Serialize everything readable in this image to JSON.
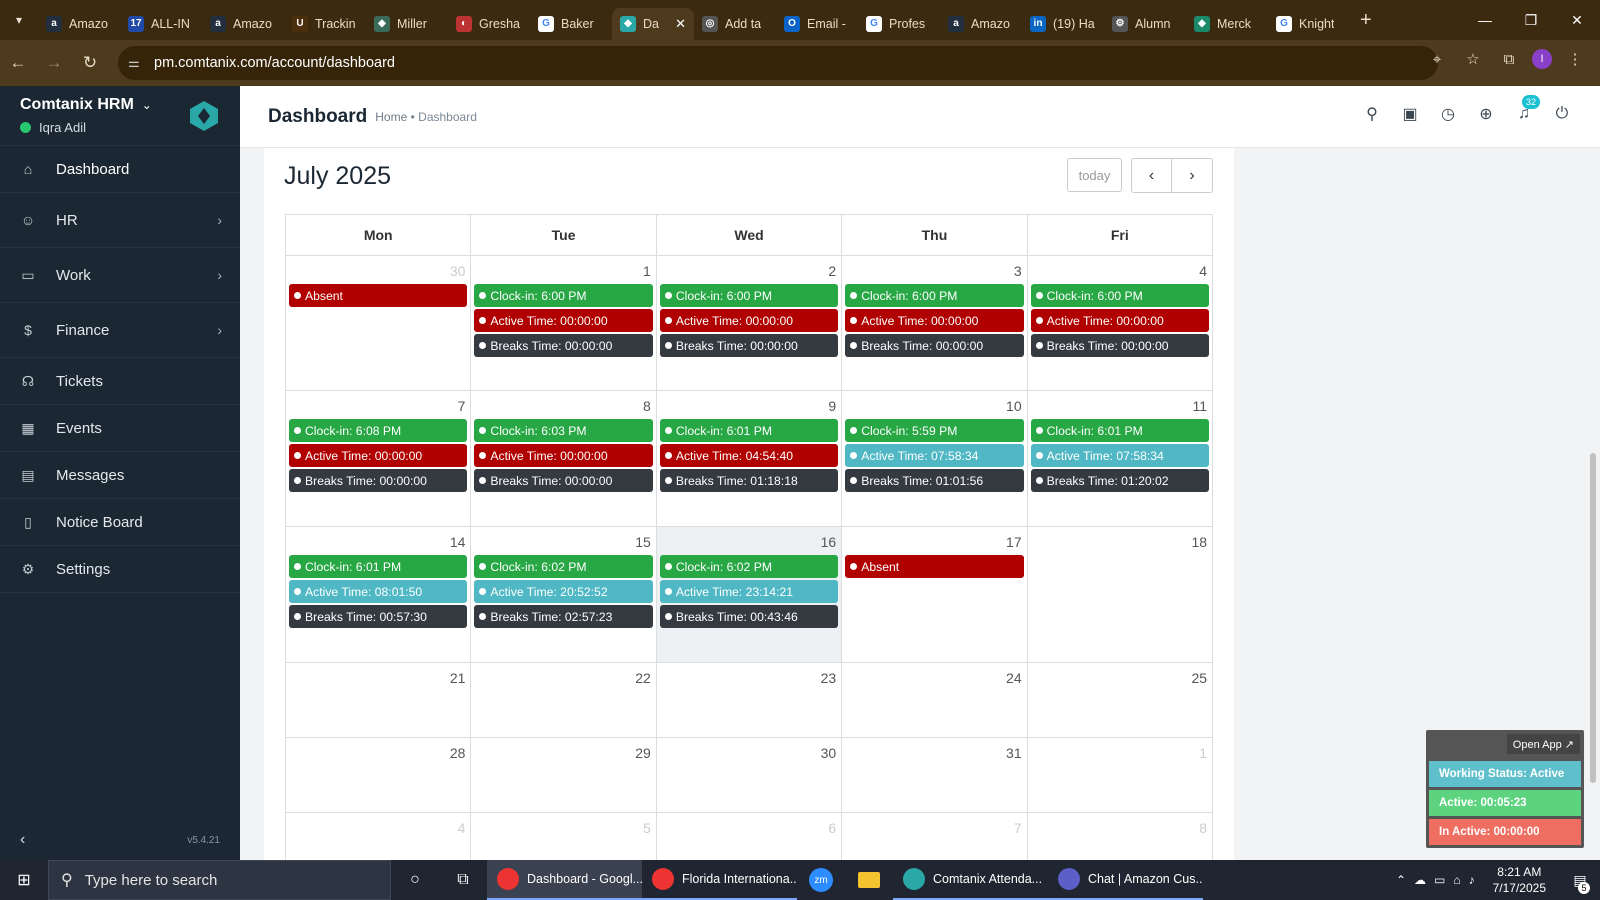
{
  "browser": {
    "tabs": [
      {
        "label": "Amazo",
        "fav": "a",
        "color": "#232f3e"
      },
      {
        "label": "ALL-IN",
        "fav": "17",
        "color": "#1f4aa8"
      },
      {
        "label": "Amazo",
        "fav": "a",
        "color": "#232f3e"
      },
      {
        "label": "Trackin",
        "fav": "U",
        "color": "#4b2e0c"
      },
      {
        "label": "Miller",
        "fav": "◆",
        "color": "#3a6b5a"
      },
      {
        "label": "Gresha",
        "fav": "◐",
        "color": "#b33"
      },
      {
        "label": "Baker",
        "fav": "G",
        "color": "#fff"
      },
      {
        "label": "Da",
        "fav": "◆",
        "color": "#2aa7a7",
        "active": true
      },
      {
        "label": "Add ta",
        "fav": "◎",
        "color": "#555"
      },
      {
        "label": "Email -",
        "fav": "O",
        "color": "#0a64c8"
      },
      {
        "label": "Profes",
        "fav": "G",
        "color": "#fff"
      },
      {
        "label": "Amazo",
        "fav": "a",
        "color": "#232f3e"
      },
      {
        "label": "(19) Ha",
        "fav": "in",
        "color": "#0a66c2"
      },
      {
        "label": "Alumn",
        "fav": "⚙",
        "color": "#555"
      },
      {
        "label": "Merck",
        "fav": "◆",
        "color": "#1b8a6b"
      },
      {
        "label": "Knight",
        "fav": "G",
        "color": "#fff"
      }
    ],
    "url": "pm.comtanix.com/account/dashboard",
    "profile_initial": "I"
  },
  "sidebar": {
    "brand": "Comtanix HRM",
    "user": "Iqra Adil",
    "items": [
      {
        "label": "Dashboard",
        "icon": "home-icon",
        "glyph": "⌂",
        "arrow": false
      },
      {
        "label": "HR",
        "icon": "users-icon",
        "glyph": "☺",
        "arrow": true
      },
      {
        "label": "Work",
        "icon": "briefcase-icon",
        "glyph": "▭",
        "arrow": true
      },
      {
        "label": "Finance",
        "icon": "dollar-icon",
        "glyph": "$",
        "arrow": true
      },
      {
        "label": "Tickets",
        "icon": "headset-icon",
        "glyph": "☊",
        "arrow": false
      },
      {
        "label": "Events",
        "icon": "calendar-icon",
        "glyph": "▦",
        "arrow": false
      },
      {
        "label": "Messages",
        "icon": "message-icon",
        "glyph": "▤",
        "arrow": false
      },
      {
        "label": "Notice Board",
        "icon": "clipboard-icon",
        "glyph": "▯",
        "arrow": false
      },
      {
        "label": "Settings",
        "icon": "gear-icon",
        "glyph": "⚙",
        "arrow": false
      }
    ],
    "version": "v5.4.21"
  },
  "header": {
    "title": "Dashboard",
    "crumb_home": "Home",
    "crumb_sep": "•",
    "crumb_current": "Dashboard",
    "notif_count": "32"
  },
  "calendar": {
    "title": "July 2025",
    "today_label": "today",
    "weekdays": [
      "Mon",
      "Tue",
      "Wed",
      "Thu",
      "Fri"
    ],
    "weeks": [
      {
        "height": 135,
        "days": [
          {
            "num": "30",
            "other": true,
            "events": [
              {
                "t": "Absent",
                "c": "red"
              }
            ]
          },
          {
            "num": "1",
            "events": [
              {
                "t": "Clock-in: 6:00 PM",
                "c": "green"
              },
              {
                "t": "Active Time: 00:00:00",
                "c": "red"
              },
              {
                "t": "Breaks Time: 00:00:00",
                "c": "dark"
              }
            ]
          },
          {
            "num": "2",
            "events": [
              {
                "t": "Clock-in: 6:00 PM",
                "c": "green"
              },
              {
                "t": "Active Time: 00:00:00",
                "c": "red"
              },
              {
                "t": "Breaks Time: 00:00:00",
                "c": "dark"
              }
            ]
          },
          {
            "num": "3",
            "events": [
              {
                "t": "Clock-in: 6:00 PM",
                "c": "green"
              },
              {
                "t": "Active Time: 00:00:00",
                "c": "red"
              },
              {
                "t": "Breaks Time: 00:00:00",
                "c": "dark"
              }
            ]
          },
          {
            "num": "4",
            "events": [
              {
                "t": "Clock-in: 6:00 PM",
                "c": "green"
              },
              {
                "t": "Active Time: 00:00:00",
                "c": "red"
              },
              {
                "t": "Breaks Time: 00:00:00",
                "c": "dark"
              }
            ]
          }
        ]
      },
      {
        "height": 136,
        "days": [
          {
            "num": "7",
            "events": [
              {
                "t": "Clock-in: 6:08 PM",
                "c": "green"
              },
              {
                "t": "Active Time: 00:00:00",
                "c": "red"
              },
              {
                "t": "Breaks Time: 00:00:00",
                "c": "dark"
              }
            ]
          },
          {
            "num": "8",
            "events": [
              {
                "t": "Clock-in: 6:03 PM",
                "c": "green"
              },
              {
                "t": "Active Time: 00:00:00",
                "c": "red"
              },
              {
                "t": "Breaks Time: 00:00:00",
                "c": "dark"
              }
            ]
          },
          {
            "num": "9",
            "events": [
              {
                "t": "Clock-in: 6:01 PM",
                "c": "green"
              },
              {
                "t": "Active Time: 04:54:40",
                "c": "red"
              },
              {
                "t": "Breaks Time: 01:18:18",
                "c": "dark"
              }
            ]
          },
          {
            "num": "10",
            "events": [
              {
                "t": "Clock-in: 5:59 PM",
                "c": "green"
              },
              {
                "t": "Active Time: 07:58:34",
                "c": "teal"
              },
              {
                "t": "Breaks Time: 01:01:56",
                "c": "dark"
              }
            ]
          },
          {
            "num": "11",
            "events": [
              {
                "t": "Clock-in: 6:01 PM",
                "c": "green"
              },
              {
                "t": "Active Time: 07:58:34",
                "c": "teal"
              },
              {
                "t": "Breaks Time: 01:20:02",
                "c": "dark"
              }
            ]
          }
        ]
      },
      {
        "height": 136,
        "days": [
          {
            "num": "14",
            "events": [
              {
                "t": "Clock-in: 6:01 PM",
                "c": "green"
              },
              {
                "t": "Active Time: 08:01:50",
                "c": "teal"
              },
              {
                "t": "Breaks Time: 00:57:30",
                "c": "dark"
              }
            ]
          },
          {
            "num": "15",
            "events": [
              {
                "t": "Clock-in: 6:02 PM",
                "c": "green"
              },
              {
                "t": "Active Time: 20:52:52",
                "c": "teal"
              },
              {
                "t": "Breaks Time: 02:57:23",
                "c": "dark"
              }
            ]
          },
          {
            "num": "16",
            "today": true,
            "events": [
              {
                "t": "Clock-in: 6:02 PM",
                "c": "green"
              },
              {
                "t": "Active Time: 23:14:21",
                "c": "teal"
              },
              {
                "t": "Breaks Time: 00:43:46",
                "c": "dark"
              }
            ]
          },
          {
            "num": "17",
            "events": [
              {
                "t": "Absent",
                "c": "red"
              }
            ]
          },
          {
            "num": "18",
            "events": []
          }
        ]
      },
      {
        "height": 75,
        "days": [
          {
            "num": "21",
            "events": []
          },
          {
            "num": "22",
            "events": []
          },
          {
            "num": "23",
            "events": []
          },
          {
            "num": "24",
            "events": []
          },
          {
            "num": "25",
            "events": []
          }
        ]
      },
      {
        "height": 75,
        "days": [
          {
            "num": "28",
            "events": []
          },
          {
            "num": "29",
            "events": []
          },
          {
            "num": "30",
            "events": []
          },
          {
            "num": "31",
            "events": []
          },
          {
            "num": "1",
            "other": true,
            "events": []
          }
        ]
      },
      {
        "height": 75,
        "days": [
          {
            "num": "4",
            "other": true,
            "events": []
          },
          {
            "num": "5",
            "other": true,
            "events": []
          },
          {
            "num": "6",
            "other": true,
            "events": []
          },
          {
            "num": "7",
            "other": true,
            "events": []
          },
          {
            "num": "8",
            "other": true,
            "events": []
          }
        ]
      }
    ]
  },
  "widget": {
    "open_app": "Open App ↗",
    "working_status": "Working Status: Active",
    "active": "Active: 00:05:23",
    "inactive": "In Active: 00:00:00"
  },
  "taskbar": {
    "search_placeholder": "Type here to search",
    "apps": [
      {
        "label": "Dashboard - Googl...",
        "color": "#e33",
        "active": true
      },
      {
        "label": "Florida Internationa...",
        "color": "#e33",
        "active": false
      }
    ],
    "apps2": [
      {
        "label": "Comtanix Attenda...",
        "color": "#2aa7a7"
      },
      {
        "label": "Chat | Amazon Cus...",
        "color": "#5b5fc7"
      }
    ],
    "time": "8:21 AM",
    "date": "7/17/2025",
    "notif_count": "5"
  },
  "colors": {
    "sidebar": "#1b2733",
    "green": "#28a745",
    "red": "#b00000",
    "dark": "#343a40",
    "teal": "#4fb8c4"
  }
}
